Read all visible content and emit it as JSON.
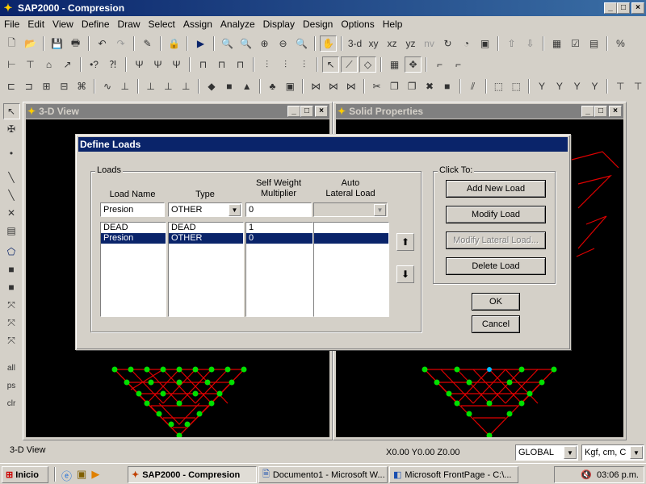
{
  "app": {
    "title": "SAP2000 - Compresion",
    "caption_buttons": [
      "_",
      "□",
      "×"
    ]
  },
  "menu": [
    "File",
    "Edit",
    "View",
    "Define",
    "Draw",
    "Select",
    "Assign",
    "Analyze",
    "Display",
    "Design",
    "Options",
    "Help"
  ],
  "toolbar1": {
    "labels": [
      "3-d",
      "xy",
      "xz",
      "yz",
      "nv"
    ]
  },
  "windows": {
    "left_title": "3-D View",
    "right_title": "Solid Properties",
    "window_buttons": [
      "_",
      "□",
      "×"
    ]
  },
  "left_toolbar": {
    "labels": [
      "all",
      "ps",
      "clr"
    ]
  },
  "dialog": {
    "title": "Define Loads",
    "loads_group_label": "Loads",
    "click_to_label": "Click To:",
    "columns": {
      "load_name": "Load Name",
      "type": "Type",
      "self_weight_line1": "Self Weight",
      "self_weight_line2": "Multiplier",
      "auto_line1": "Auto",
      "auto_line2": "Lateral Load"
    },
    "inputs": {
      "load_name": "Presion",
      "type": "OTHER",
      "multiplier": "0",
      "auto_lateral": ""
    },
    "rows": [
      {
        "name": "DEAD",
        "type": "DEAD",
        "multiplier": "1",
        "auto": "",
        "selected": false
      },
      {
        "name": "Presion",
        "type": "OTHER",
        "multiplier": "0",
        "auto": "",
        "selected": true
      }
    ],
    "buttons": {
      "add": "Add New Load",
      "modify": "Modify Load",
      "modify_lateral": "Modify Lateral Load...",
      "delete": "Delete Load",
      "ok": "OK",
      "cancel": "Cancel"
    }
  },
  "status": {
    "view_label": "3-D View",
    "coords": "X0.00  Y0.00  Z0.00",
    "coord_system": "GLOBAL",
    "units": "Kgf, cm, C"
  },
  "taskbar": {
    "start": "Inicio",
    "tasks": [
      "SAP2000 - Compresion",
      "Documento1 - Microsoft W...",
      "Microsoft FrontPage - C:\\..."
    ],
    "clock": "03:06 p.m."
  },
  "colors": {
    "title_active": "#0a246a",
    "title_inactive": "#808080",
    "frame_red": "#e00000",
    "joint_green": "#00e000",
    "face": "#d4d0c8"
  }
}
